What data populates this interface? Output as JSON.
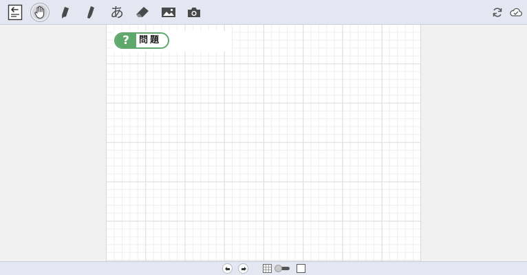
{
  "toolbar": {
    "tools": [
      {
        "name": "back-to-list-icon"
      },
      {
        "name": "hand-icon",
        "active": true
      },
      {
        "name": "pen-icon"
      },
      {
        "name": "marker-icon"
      },
      {
        "name": "text-icon",
        "label": "あ"
      },
      {
        "name": "eraser-icon"
      },
      {
        "name": "image-icon"
      },
      {
        "name": "camera-icon"
      }
    ],
    "right": [
      {
        "name": "sync-icon"
      },
      {
        "name": "cloud-icon"
      }
    ]
  },
  "canvas": {
    "badge_mark": "?",
    "badge_label": "問題",
    "grid": "on"
  },
  "footer": {
    "buttons": [
      "undo-icon",
      "redo-icon",
      "grid-icon",
      "grid-toggle",
      "blank-page-icon"
    ],
    "grid_toggle": "off"
  },
  "colors": {
    "toolbar_bg": "#e4e6f2",
    "badge_accent": "#5ea86b",
    "page_bg": "#f1f1f1"
  }
}
